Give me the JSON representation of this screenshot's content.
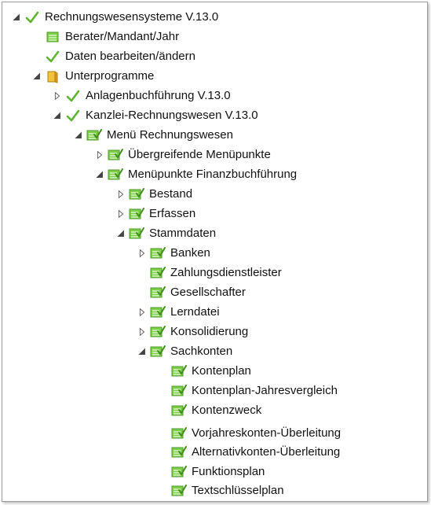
{
  "tree": {
    "root": "Rechnungswesensysteme V.13.0",
    "berater": "Berater/Mandant/Jahr",
    "daten": "Daten bearbeiten/ändern",
    "unterprogramme": "Unterprogramme",
    "anlagen": "Anlagenbuchführung V.13.0",
    "kanzlei": "Kanzlei-Rechnungswesen V.13.0",
    "menu": "Menü Rechnungswesen",
    "uebergreifend": "Übergreifende Menüpunkte",
    "fibu": "Menüpunkte Finanzbuchführung",
    "bestand": "Bestand",
    "erfassen": "Erfassen",
    "stammdaten": "Stammdaten",
    "banken": "Banken",
    "zahlungs": "Zahlungsdienstleister",
    "gesell": "Gesellschafter",
    "lern": "Lerndatei",
    "konsol": "Konsolidierung",
    "sachkonten": "Sachkonten",
    "kontenplan": "Kontenplan",
    "kontenplan_jv": "Kontenplan-Jahresvergleich",
    "kontenzweck": "Kontenzweck",
    "vorjahres": "Vorjahreskonten-Überleitung",
    "alternativ": "Alternativkonten-Überleitung",
    "funktionsplan": "Funktionsplan",
    "textschluessel": "Textschlüsselplan"
  },
  "icons": {
    "check": "check-icon",
    "list": "list-icon",
    "folder": "folder-icon",
    "menu_item": "menu-check-icon"
  },
  "colors": {
    "check": "#5cb531",
    "icon_green": "#6bbf3a",
    "folder": "#e0a81f"
  }
}
